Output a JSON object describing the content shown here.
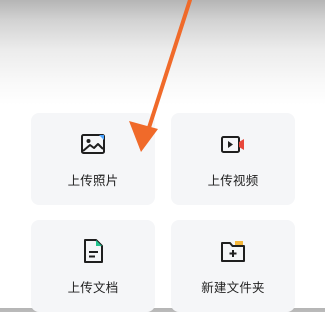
{
  "upload_sheet": {
    "items": [
      {
        "label": "上传照片",
        "icon": "image-icon"
      },
      {
        "label": "上传视频",
        "icon": "video-icon"
      },
      {
        "label": "上传文档",
        "icon": "document-icon"
      },
      {
        "label": "新建文件夹",
        "icon": "new-folder-icon"
      }
    ]
  },
  "colors": {
    "tile_background": "#f5f6f8",
    "icon_stroke": "#1f1f1f",
    "accent_green": "#22c38e",
    "accent_blue": "#4aa3ff",
    "annotation_arrow": "#f06a2a"
  }
}
